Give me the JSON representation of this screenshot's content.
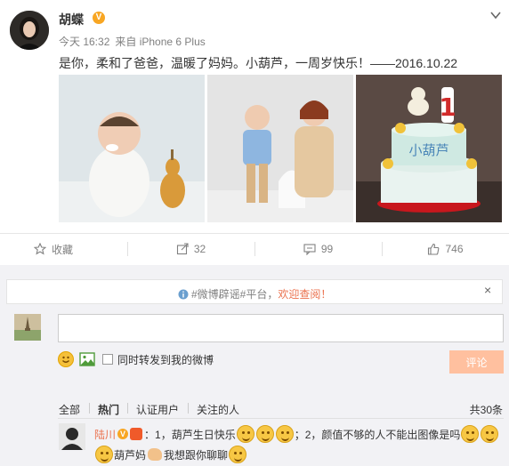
{
  "post": {
    "author": "胡蝶",
    "verified_badge": "V",
    "time": "今天 16:32",
    "source": "来自 iPhone 6 Plus",
    "content": "是你，柔和了爸爸，温暖了妈妈。小葫芦，一周岁快乐！——2016.10.22",
    "cake_text": "小葫芦",
    "cake_number": "1"
  },
  "actions": {
    "favorite_label": "收藏",
    "repost_count": "32",
    "comment_count": "99",
    "like_count": "746"
  },
  "comments": {
    "notice": {
      "prefix_tag": "#微博辟谣#平台，",
      "link": "欢迎查阅！",
      "close": "×"
    },
    "input_placeholder": "",
    "repost_checkbox_label": "同时转发到我的微博",
    "submit_label": "评论",
    "filters": [
      "全部",
      "热门",
      "认证用户",
      "关注的人"
    ],
    "total": "共30条",
    "first_comment": {
      "user": "陆川",
      "verified_badge": "V",
      "text_a": "：1，葫芦生日快乐",
      "text_b": "；2，颜值不够的人不能出图像是吗",
      "mention": "葫芦妈",
      "text_c": "我想跟你聊聊"
    }
  },
  "colors": {
    "accent": "#eb7350",
    "verified": "#f8a623",
    "submit_disabled": "#ffc09f",
    "comments_bg": "#f2f2f5"
  }
}
